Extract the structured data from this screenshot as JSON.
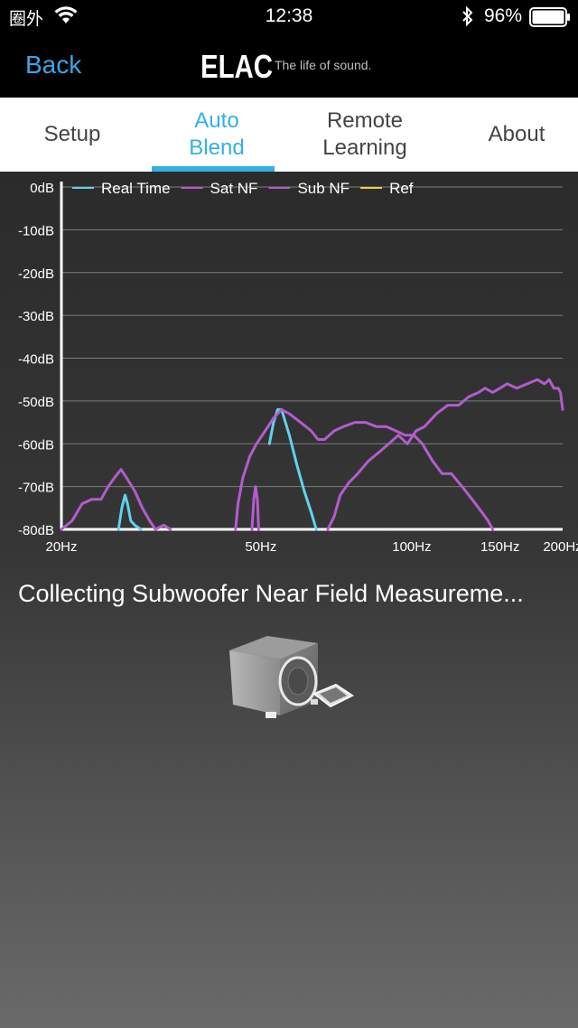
{
  "status_bar": {
    "carrier": "圈外",
    "time": "12:38",
    "battery": "96%",
    "icons": [
      "wifi-icon",
      "bluetooth-icon",
      "battery-icon"
    ]
  },
  "nav": {
    "back_label": "Back",
    "brand": "ELAC",
    "tagline": "The life of sound."
  },
  "tabs": [
    {
      "line1": "Setup",
      "line2": "",
      "active": false
    },
    {
      "line1": "Auto",
      "line2": "Blend",
      "active": true
    },
    {
      "line1": "Remote",
      "line2": "Learning",
      "active": false
    },
    {
      "line1": "About",
      "line2": "",
      "active": false
    }
  ],
  "colors": {
    "accent": "#33b0e0",
    "real_time": "#5fd3ec",
    "sat_nf": "#b35ccf",
    "sub_nf": "#b35ccf",
    "ref": "#e8d23a"
  },
  "chart_data": {
    "type": "line",
    "x_scale": "log",
    "xlim": [
      20,
      200
    ],
    "ylim": [
      -80,
      0
    ],
    "x_ticks": [
      {
        "value": 20,
        "label": "20Hz"
      },
      {
        "value": 50,
        "label": "50Hz"
      },
      {
        "value": 100,
        "label": "100Hz"
      },
      {
        "value": 150,
        "label": "150Hz"
      },
      {
        "value": 200,
        "label": "200Hz"
      }
    ],
    "y_ticks": [
      {
        "value": 0,
        "label": "0dB"
      },
      {
        "value": -10,
        "label": "-10dB"
      },
      {
        "value": -20,
        "label": "-20dB"
      },
      {
        "value": -30,
        "label": "-30dB"
      },
      {
        "value": -40,
        "label": "-40dB"
      },
      {
        "value": -50,
        "label": "-50dB"
      },
      {
        "value": -60,
        "label": "-60dB"
      },
      {
        "value": -70,
        "label": "-70dB"
      },
      {
        "value": -80,
        "label": "-80dB"
      }
    ],
    "grid": true,
    "legend_position": "top",
    "series": [
      {
        "name": "Real Time",
        "color": "#5fd3ec",
        "segments": [
          [
            [
              26.0,
              -80
            ],
            [
              26.4,
              -75
            ],
            [
              26.8,
              -72
            ],
            [
              27.1,
              -74
            ],
            [
              27.5,
              -78
            ],
            [
              28.0,
              -79
            ],
            [
              28.8,
              -80
            ]
          ],
          [
            [
              52.0,
              -60
            ],
            [
              53.0,
              -55
            ],
            [
              54.0,
              -52
            ],
            [
              55.0,
              -52
            ],
            [
              57.0,
              -58
            ],
            [
              59.0,
              -65
            ],
            [
              61.0,
              -71
            ],
            [
              63.0,
              -76
            ],
            [
              64.5,
              -80
            ]
          ]
        ]
      },
      {
        "name": "Sat NF",
        "color": "#b35ccf",
        "segments": [
          [
            [
              68.0,
              -80
            ],
            [
              70.0,
              -77
            ],
            [
              72.0,
              -72
            ],
            [
              75.0,
              -69
            ],
            [
              78.0,
              -67
            ],
            [
              82.0,
              -64
            ],
            [
              86.0,
              -62
            ],
            [
              90.0,
              -60
            ],
            [
              94.0,
              -58
            ],
            [
              98.0,
              -60
            ],
            [
              102.0,
              -57
            ],
            [
              106.0,
              -56
            ],
            [
              112.0,
              -53
            ],
            [
              118.0,
              -51
            ],
            [
              124.0,
              -51
            ],
            [
              130.0,
              -49
            ],
            [
              136.0,
              -48
            ],
            [
              140.0,
              -47
            ],
            [
              145.0,
              -48
            ],
            [
              150.0,
              -47
            ],
            [
              155.0,
              -46
            ],
            [
              162.0,
              -47
            ],
            [
              170.0,
              -46
            ],
            [
              178.0,
              -45
            ],
            [
              184.0,
              -46
            ],
            [
              188.0,
              -45
            ],
            [
              192.0,
              -47
            ],
            [
              196.0,
              -47
            ],
            [
              198.0,
              -48
            ],
            [
              200.0,
              -52
            ]
          ]
        ]
      },
      {
        "name": "Sub NF",
        "color": "#b35ccf",
        "segments": [
          [
            [
              20.0,
              -80
            ],
            [
              21.0,
              -78
            ],
            [
              22.0,
              -74
            ],
            [
              23.0,
              -73
            ],
            [
              24.0,
              -73
            ],
            [
              24.8,
              -70
            ],
            [
              25.5,
              -68
            ],
            [
              26.3,
              -66
            ],
            [
              27.0,
              -68
            ],
            [
              28.0,
              -71
            ],
            [
              29.0,
              -75
            ],
            [
              30.0,
              -78
            ],
            [
              30.8,
              -80
            ],
            [
              32.0,
              -79
            ],
            [
              33.0,
              -80
            ]
          ],
          [
            [
              44.5,
              -80
            ],
            [
              45.0,
              -74
            ],
            [
              46.0,
              -68
            ],
            [
              47.5,
              -63
            ],
            [
              49.0,
              -60
            ],
            [
              51.0,
              -57
            ],
            [
              53.0,
              -54
            ],
            [
              55.0,
              -52
            ],
            [
              57.0,
              -53
            ],
            [
              60.0,
              -55
            ],
            [
              63.0,
              -57
            ],
            [
              65.0,
              -59
            ],
            [
              67.0,
              -59
            ],
            [
              70.0,
              -57
            ],
            [
              73.0,
              -56
            ],
            [
              77.0,
              -55
            ],
            [
              81.0,
              -55
            ],
            [
              85.0,
              -56
            ],
            [
              89.0,
              -56
            ],
            [
              93.0,
              -57
            ],
            [
              97.0,
              -58
            ],
            [
              101.0,
              -58
            ],
            [
              105.0,
              -60
            ],
            [
              110.0,
              -64
            ],
            [
              115.0,
              -67
            ],
            [
              120.0,
              -67
            ],
            [
              126.0,
              -70
            ],
            [
              132.0,
              -73
            ],
            [
              138.0,
              -76
            ],
            [
              142.0,
              -78
            ],
            [
              145.0,
              -80
            ]
          ],
          [
            [
              48.0,
              -80
            ],
            [
              48.4,
              -73
            ],
            [
              48.8,
              -70
            ],
            [
              49.2,
              -73
            ],
            [
              49.5,
              -80
            ]
          ]
        ]
      },
      {
        "name": "Ref",
        "color": "#e8d23a",
        "segments": []
      }
    ]
  },
  "status_message": "Collecting Subwoofer Near Field Measureme..."
}
